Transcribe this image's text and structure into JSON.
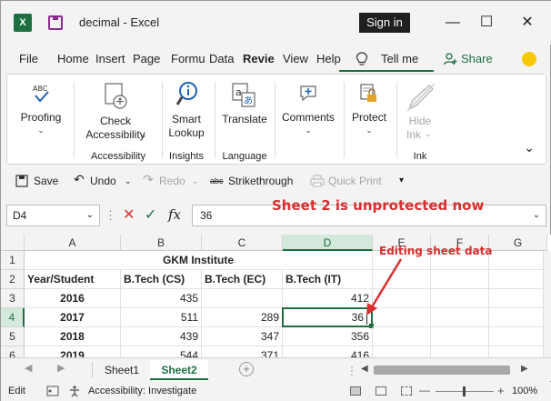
{
  "window": {
    "app_icon": "excel-icon",
    "title": "decimal  -  Excel",
    "signin_label": "Sign in",
    "controls": [
      "—",
      "☐",
      "✕"
    ]
  },
  "tabs": [
    "File",
    "Home",
    "Insert",
    "Page",
    "Formu",
    "Data",
    "Revie",
    "View",
    "Help",
    "Tell me"
  ],
  "share_label": "Share",
  "ribbon": {
    "proofing": {
      "label": "Proofing",
      "icon": "spelling-abc-icon"
    },
    "check_accessibility": {
      "line1": "Check",
      "line2": "Accessibility",
      "icon": "accessibility-checker-icon"
    },
    "smart_lookup": {
      "line1": "Smart",
      "line2": "Lookup",
      "icon": "smart-lookup-icon"
    },
    "translate": {
      "label": "Translate",
      "icon": "translate-icon"
    },
    "comments": {
      "label": "Comments",
      "icon": "comment-icon"
    },
    "protect": {
      "label": "Protect",
      "icon": "protect-lock-icon"
    },
    "hide_ink": {
      "line1": "Hide",
      "line2": "Ink",
      "icon": "pen-icon"
    },
    "groups": {
      "accessibility": "Accessibility",
      "insights": "Insights",
      "language": "Language",
      "ink": "Ink"
    }
  },
  "quick_access": {
    "save": "Save",
    "undo": "Undo",
    "redo": "Redo",
    "strikethrough": "Strikethrough",
    "strikethrough_icon_text": "abc",
    "quick_print": "Quick Print"
  },
  "formula_bar": {
    "name_box": "D4",
    "fx": "fx",
    "value": "36"
  },
  "annotations": {
    "top": "Sheet 2 is unprotected now",
    "side": "Editing sheet data"
  },
  "grid": {
    "columns": [
      "A",
      "B",
      "C",
      "D",
      "E",
      "F",
      "G"
    ],
    "rows": [
      "1",
      "2",
      "3",
      "4",
      "5",
      "6"
    ],
    "title": "GKM Institute",
    "headers": [
      "Year/Student",
      "B.Tech (CS)",
      "B.Tech (EC)",
      "B.Tech (IT)"
    ],
    "data": [
      [
        "2016",
        "435",
        "",
        "412"
      ],
      [
        "2017",
        "511",
        "289",
        "36"
      ],
      [
        "2018",
        "439",
        "347",
        "356"
      ],
      [
        "2019",
        "544",
        "371",
        "416"
      ]
    ]
  },
  "sheets": [
    "Sheet1",
    "Sheet2"
  ],
  "status": {
    "mode": "Edit",
    "accessibility": "Accessibility: Investigate",
    "zoom": "100%"
  },
  "colors": {
    "accent": "#1d6f42",
    "annotation": "#d92f2f"
  }
}
